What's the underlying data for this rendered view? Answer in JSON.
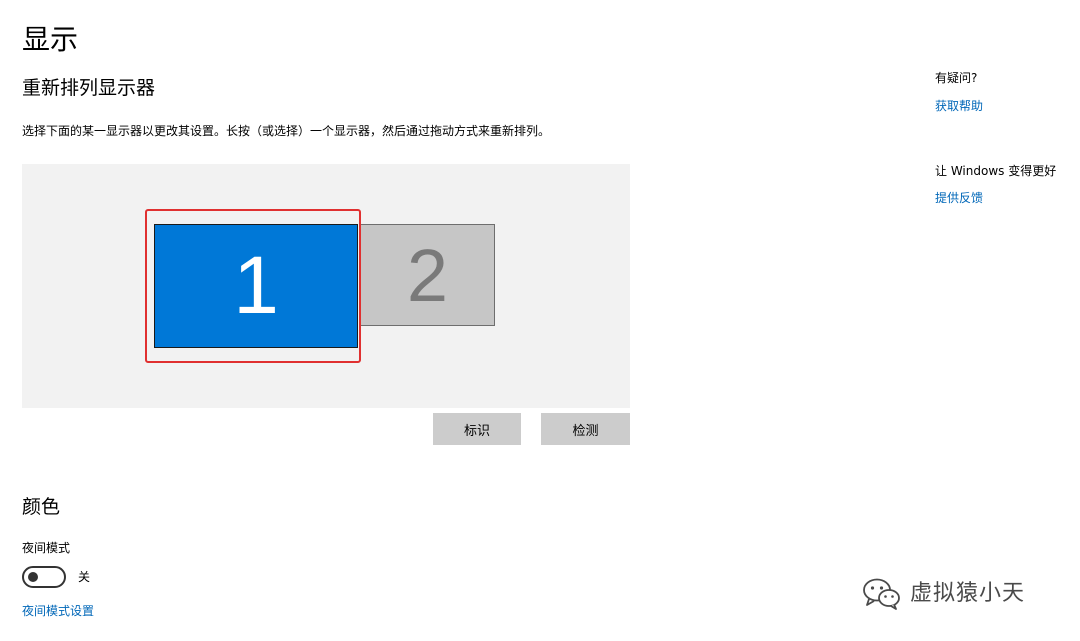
{
  "page": {
    "title": "显示"
  },
  "arrange": {
    "title": "重新排列显示器",
    "description": "选择下面的某一显示器以更改其设置。长按（或选择）一个显示器，然后通过拖动方式来重新排列。",
    "monitors": [
      {
        "label": "1",
        "selected": true
      },
      {
        "label": "2",
        "selected": false
      }
    ],
    "identify_label": "标识",
    "detect_label": "检测"
  },
  "color": {
    "title": "颜色",
    "night_light_label": "夜间模式",
    "night_light_state": "关",
    "night_light_on": false,
    "night_light_settings_link": "夜间模式设置"
  },
  "sidebar": {
    "help_title": "有疑问?",
    "help_link": "获取帮助",
    "feedback_title": "让 Windows 变得更好",
    "feedback_link": "提供反馈"
  },
  "watermark": {
    "text": "虚拟猿小天"
  },
  "colors": {
    "accent": "#0078d7",
    "link": "#0067b8",
    "selection_outline": "#e03030",
    "arrange_background": "#f2f2f2",
    "button_background": "#cccccc"
  },
  "icons": {
    "watermark_icon": "wechat-icon"
  }
}
